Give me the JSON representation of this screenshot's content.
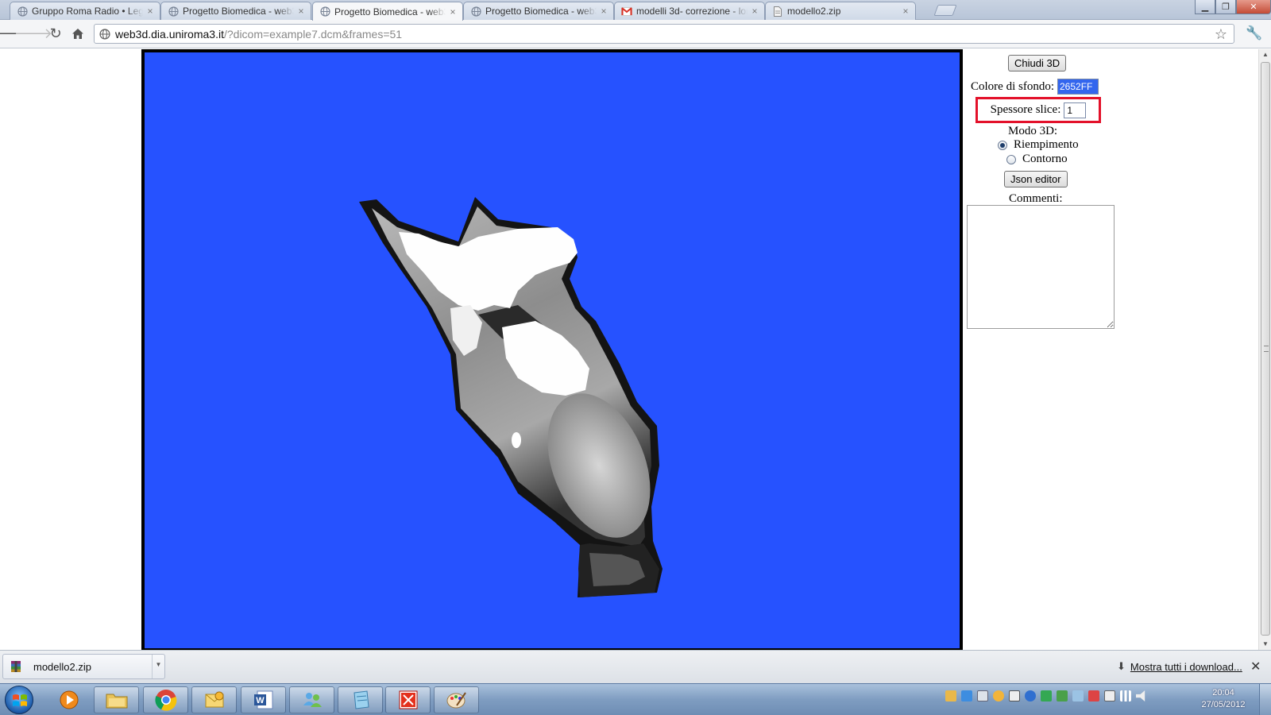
{
  "browser": {
    "tabs": [
      {
        "title": "Gruppo Roma Radio • Legg",
        "active": false,
        "favicon": "globe-icon"
      },
      {
        "title": "Progetto Biomedica - web3",
        "active": false,
        "favicon": "globe-icon"
      },
      {
        "title": "Progetto Biomedica - web3",
        "active": true,
        "favicon": "globe-icon"
      },
      {
        "title": "Progetto Biomedica - web3",
        "active": false,
        "favicon": "globe-icon"
      },
      {
        "title": "modelli 3d- correzione - lor",
        "active": false,
        "favicon": "gmail-icon"
      },
      {
        "title": "modello2.zip",
        "active": false,
        "favicon": "document-icon"
      }
    ],
    "url_host": "web3d.dia.uniroma3.it",
    "url_path": "/?dicom=example7.dcm&frames=51"
  },
  "viewer": {
    "background_color": "#2652FF"
  },
  "controls": {
    "close_3d_label": "Chiudi 3D",
    "background_label": "Colore di sfondo:",
    "background_value": "2652FF",
    "thickness_label": "Spessore slice:",
    "thickness_value": "1",
    "mode_label": "Modo 3D:",
    "mode_options": [
      {
        "label": "Riempimento",
        "checked": true
      },
      {
        "label": "Contorno",
        "checked": false
      }
    ],
    "json_editor_label": "Json editor",
    "comments_label": "Commenti:",
    "comments_value": "",
    "highlight_color": "#E3112A"
  },
  "downloads": {
    "file_name": "modello2.zip",
    "show_all_label": "Mostra tutti i download..."
  },
  "taskbar": {
    "apps": [
      "media-player-icon",
      "file-explorer-icon",
      "chrome-icon",
      "outlook-icon",
      "word-icon",
      "messenger-icon",
      "notepad-icon",
      "acrobat-icon",
      "paint-icon"
    ],
    "time": "20:04",
    "date": "27/05/2012"
  }
}
